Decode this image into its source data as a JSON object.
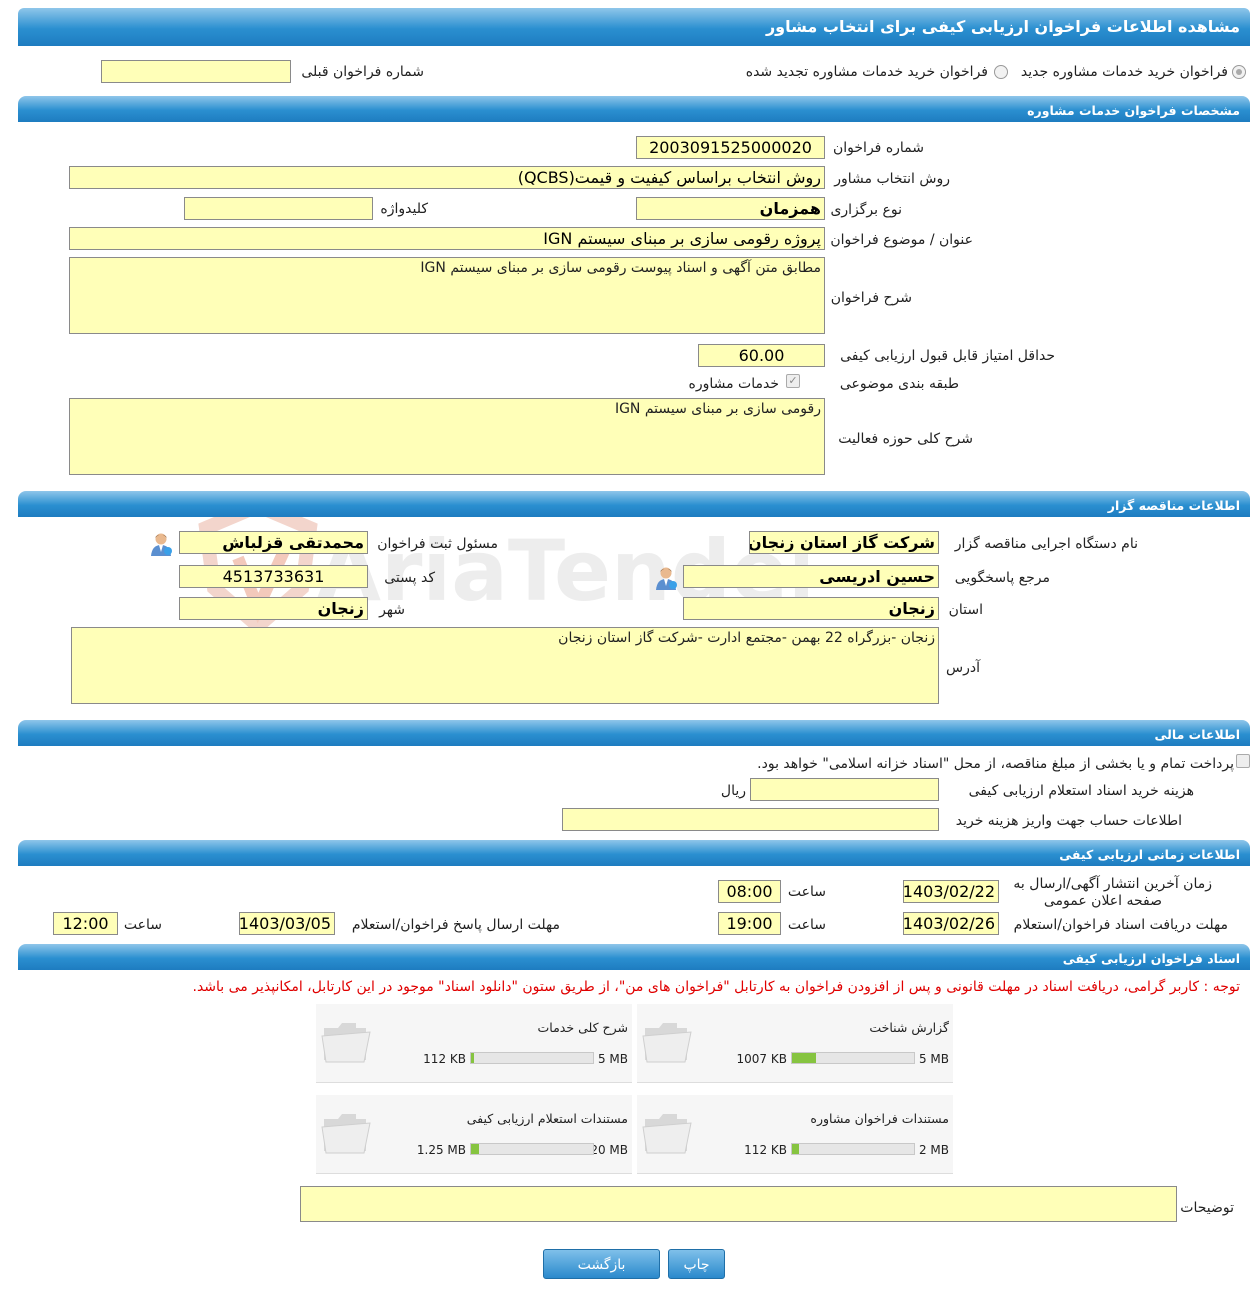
{
  "page_title": "مشاهده اطلاعات فراخوان ارزیابی کیفی برای انتخاب مشاور",
  "options": {
    "radio_new": "فراخوان خرید خدمات مشاوره جدید",
    "radio_renewed": "فراخوان خرید خدمات مشاوره تجدید شده",
    "prev_call_label": "شماره فراخوان قبلی",
    "prev_call_value": ""
  },
  "consulting": {
    "section_title": "مشخصات فراخوان خدمات مشاوره",
    "call_number_label": "شماره فراخوان",
    "call_number": "2003091525000020",
    "selection_method_label": "روش انتخاب مشاور",
    "selection_method": "روش انتخاب براساس کیفیت و قیمت(QCBS)",
    "holding_type_label": "نوع برگزاری",
    "holding_type": "همزمان",
    "keyword_label": "کلیدواژه",
    "keyword": "",
    "subject_label": "عنوان / موضوع فراخوان",
    "subject": "پروژه رقومی سازی بر مبنای سیستم IGN",
    "description_label": "شرح فراخوان",
    "description": "مطابق متن آگهی و اسناد پیوست رقومی سازی بر مبنای سیستم IGN",
    "min_score_label": "حداقل امتیاز قابل قبول ارزیابی کیفی",
    "min_score": "60.00",
    "category_label": "طبقه بندی موضوعی",
    "category_value": "خدمات مشاوره",
    "activity_label": "شرح کلی حوزه فعالیت",
    "activity": "رقومی سازی بر مبنای سیستم IGN"
  },
  "tenderer": {
    "section_title": "اطلاعات مناقصه گزار",
    "org_label": "نام دستگاه اجرایی مناقصه گزار",
    "org": "شرکت گاز استان زنجان",
    "registrar_label": "مسئول ثبت فراخوان",
    "registrar": "محمدتقی قزلباش",
    "reference_label": "مرجع پاسخگویی",
    "reference": "حسین ادریسی",
    "postal_label": "کد پستی",
    "postal": "4513733631",
    "province_label": "استان",
    "province": "زنجان",
    "city_label": "شهر",
    "city": "زنجان",
    "address_label": "آدرس",
    "address": "زنجان -بزرگراه 22 بهمن -مجتمع ادارت -شرکت گاز استان زنجان"
  },
  "financial": {
    "section_title": "اطلاعات مالی",
    "treasury_text": "پرداخت تمام و یا بخشی از مبلغ مناقصه، از محل \"اسناد خزانه اسلامی\" خواهد بود.",
    "cost_label": "هزینه خرید اسناد استعلام ارزیابی کیفی",
    "cost": "",
    "currency": "ریال",
    "account_label": "اطلاعات حساب جهت واریز هزینه خرید",
    "account": ""
  },
  "timing": {
    "section_title": "اطلاعات زمانی ارزیابی کیفی",
    "publish_label_1": "زمان آخرین انتشار آگهی/ارسال به",
    "publish_label_2": "صفحه اعلان عمومی",
    "publish_date": "1403/02/22",
    "publish_time": "08:00",
    "receive_label": "مهلت دریافت اسناد فراخوان/استعلام",
    "receive_date": "1403/02/26",
    "receive_time": "19:00",
    "send_label": "مهلت ارسال پاسخ فراخوان/استعلام",
    "send_date": "1403/03/05",
    "send_time": "12:00",
    "time_label": "ساعت"
  },
  "documents": {
    "section_title": "اسناد فراخوان ارزیابی کیفی",
    "note": "توجه : کاربر گرامی، دریافت اسناد در مهلت قانونی و پس از افزودن فراخوان به کارتابل \"فراخوان های من\"، از طریق ستون \"دانلود اسناد\" موجود در این کارتابل، امکانپذیر می باشد.",
    "files": [
      {
        "name": "گزارش شناخت",
        "size": "1007 KB",
        "max": "5 MB",
        "fraction": 0.197
      },
      {
        "name": "شرح کلی خدمات",
        "size": "112 KB",
        "max": "5 MB",
        "fraction": 0.022
      },
      {
        "name": "مستندات فراخوان مشاوره",
        "size": "112 KB",
        "max": "2 MB",
        "fraction": 0.055
      },
      {
        "name": "مستندات استعلام ارزیابی کیفی",
        "size": "1.25 MB",
        "max": "20 MB",
        "fraction": 0.0625
      }
    ],
    "remarks_label": "توضیحات",
    "remarks": ""
  },
  "buttons": {
    "print": "چاپ",
    "back": "بازگشت"
  },
  "watermark": "AriaTender.neT",
  "colors": {
    "header": "#2a8fd0",
    "field_bg": "#ffffb8",
    "note": "#e00000",
    "progress": "#86c440"
  }
}
